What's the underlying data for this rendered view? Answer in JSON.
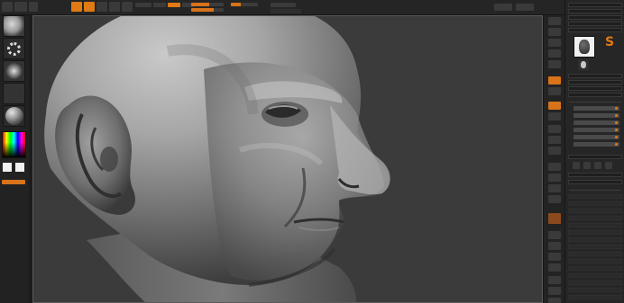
{
  "top_bar": {
    "buttons": [
      "edit-button",
      "draw-button",
      "move-button",
      "scale-button",
      "rotate-button"
    ],
    "sliders": [
      {
        "name": "focal-shift-slider",
        "level": 0.55
      },
      {
        "name": "draw-size-slider",
        "level": 0.7
      },
      {
        "name": "z-intensity-slider",
        "level": 0.35
      }
    ]
  },
  "left_shelf": {
    "brush_icon": "brush-preview-icon",
    "stroke_icon": "stroke-dots-icon",
    "alpha_icon": "alpha-preview-icon",
    "material_icon": "material-ball-icon",
    "main_color": "#f2f2f2",
    "secondary_color": "#f2f2f2",
    "accent": "#d8731a"
  },
  "canvas": {
    "background": "#3b3b3b",
    "subject_icon": "sculpted-head-icon"
  },
  "right_shelf": {
    "accent": "#d8731a",
    "button_count": 24
  },
  "right_tray": {
    "tool_icon": "head-tool-icon",
    "lightbox_icon": "goz-icon",
    "accent": "#e07a14"
  }
}
